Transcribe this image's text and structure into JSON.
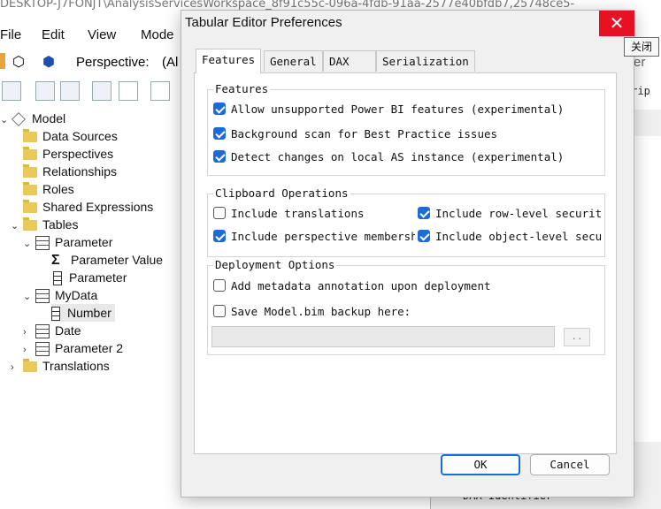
{
  "background": {
    "window_title": "DESKTOP-J7FONJT\\AnalysisServicesWorkspace_8f91c55c-096a-4fdb-91aa-2577e40bfdb7,25748ce5-",
    "menu": [
      "File",
      "Edit",
      "View",
      "Mode"
    ],
    "perspective_label": "Perspective:",
    "perspective_value": "(Al",
    "right_edge_text_1": "er",
    "right_edge_text_2": "crip",
    "bottom_text": "DAX Identifier",
    "tree": [
      {
        "label": "Model",
        "icon": "model-icon"
      },
      {
        "label": "Data Sources",
        "icon": "folder-icon"
      },
      {
        "label": "Perspectives",
        "icon": "folder-icon"
      },
      {
        "label": "Relationships",
        "icon": "folder-icon"
      },
      {
        "label": "Roles",
        "icon": "folder-icon"
      },
      {
        "label": "Shared Expressions",
        "icon": "folder-icon"
      },
      {
        "label": "Tables",
        "icon": "folder-icon"
      },
      {
        "label": "Parameter",
        "icon": "table-icon"
      },
      {
        "label": "Parameter Value",
        "icon": "measure-icon"
      },
      {
        "label": "Parameter",
        "icon": "column-icon"
      },
      {
        "label": "MyData",
        "icon": "table-icon"
      },
      {
        "label": "Number",
        "icon": "column-icon"
      },
      {
        "label": "Date",
        "icon": "table-icon"
      },
      {
        "label": "Parameter 2",
        "icon": "table-icon"
      },
      {
        "label": "Translations",
        "icon": "folder-icon"
      }
    ]
  },
  "dialog": {
    "title": "Tabular Editor Preferences",
    "close_tooltip": "关闭",
    "close_glyph": "✕",
    "tabs": [
      "Features",
      "General",
      "DAX",
      "Serialization"
    ],
    "active_tab": "Features",
    "groups": {
      "features": {
        "label": "Features",
        "options": [
          {
            "label": "Allow unsupported Power BI features (experimental)",
            "checked": true
          },
          {
            "label": "Background scan for Best Practice issues",
            "checked": true
          },
          {
            "label": "Detect changes on local AS instance (experimental)",
            "checked": true
          }
        ]
      },
      "clipboard": {
        "label": "Clipboard Operations",
        "options": [
          {
            "label": "Include translations",
            "checked": false
          },
          {
            "label": "Include row-level securit",
            "checked": true
          },
          {
            "label": "Include perspective membersh",
            "checked": true
          },
          {
            "label": "Include object-level secu",
            "checked": true
          }
        ]
      },
      "deployment": {
        "label": "Deployment Options",
        "options": [
          {
            "label": "Add metadata annotation upon deployment",
            "checked": false
          },
          {
            "label": "Save Model.bim backup here:",
            "checked": false
          }
        ],
        "backup_path": "",
        "browse_label": ".."
      }
    },
    "buttons": {
      "ok": "OK",
      "cancel": "Cancel"
    }
  }
}
